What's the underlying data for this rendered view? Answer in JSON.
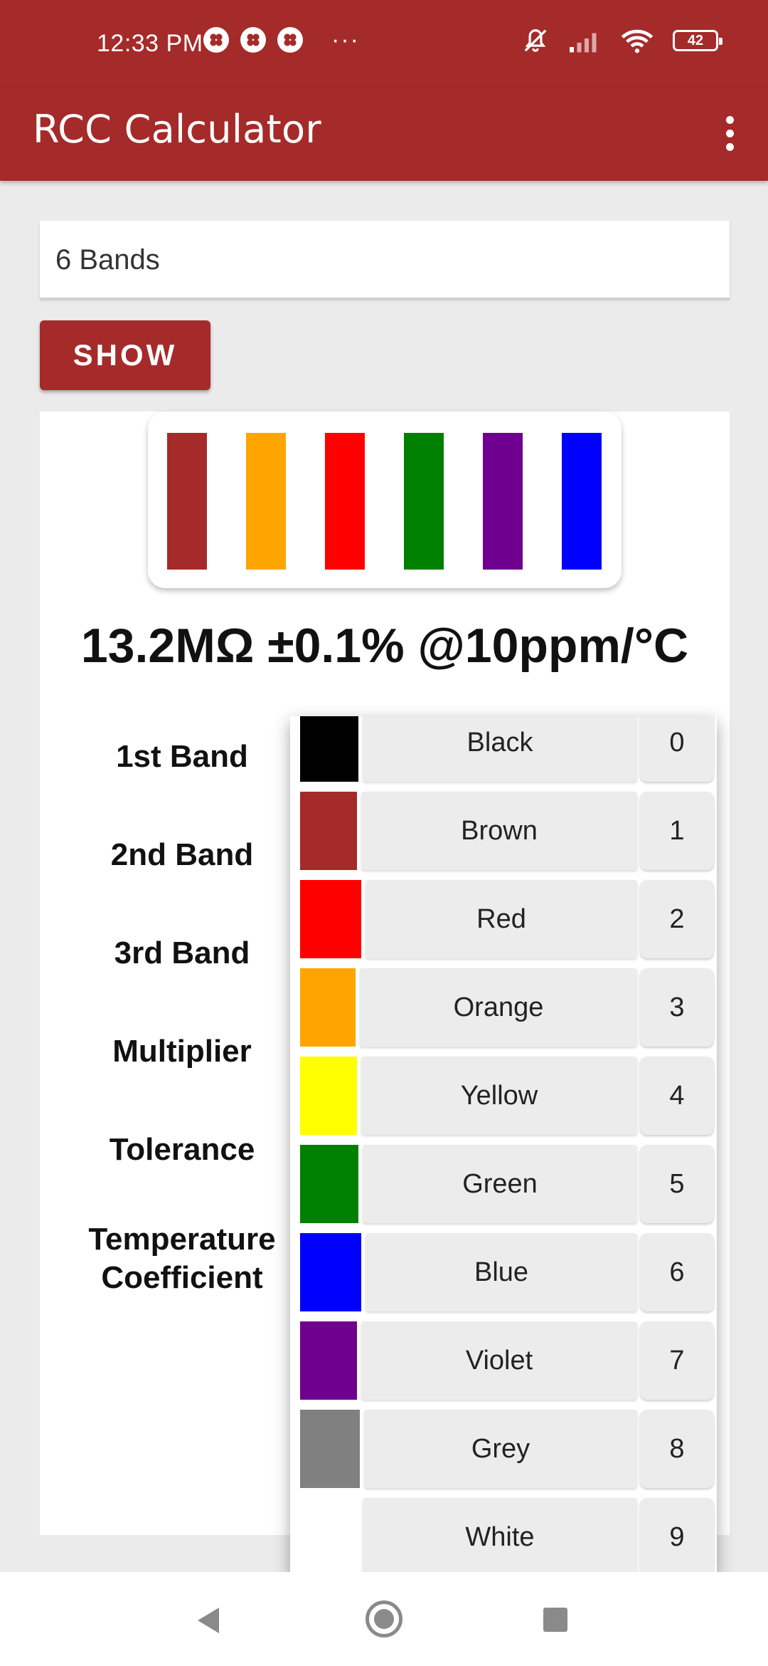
{
  "status_bar": {
    "time": "12:33 PM",
    "more_indicator": "···",
    "battery_level": "42",
    "icons": [
      "fan-icon",
      "fan-icon",
      "fan-icon",
      "mute-bell-icon",
      "signal-icon",
      "wifi-icon",
      "battery-icon"
    ]
  },
  "app_bar": {
    "title": "RCC Calculator",
    "menu_icon": "more-vert-icon"
  },
  "spinner": {
    "selected": "6 Bands"
  },
  "show_button": {
    "label": "SHOW"
  },
  "resistor": {
    "bands": [
      {
        "color": "#a52a2a"
      },
      {
        "color": "#ffa500"
      },
      {
        "color": "#ff0000"
      },
      {
        "color": "#008000"
      },
      {
        "color": "#6f008f"
      },
      {
        "color": "#0000ff"
      }
    ]
  },
  "result": "13.2MΩ ±0.1% @10ppm/°C",
  "labels": {
    "band1": "1st Band",
    "band2": "2nd Band",
    "band3": "3rd Band",
    "multiplier": "Multiplier",
    "tolerance": "Tolerance",
    "temp_line1": "Temperature",
    "temp_line2": "Coefficient"
  },
  "dropdown": {
    "items": [
      {
        "name": "Black",
        "digit": "0",
        "color": "#000000"
      },
      {
        "name": "Brown",
        "digit": "1",
        "color": "#a52a2a"
      },
      {
        "name": "Red",
        "digit": "2",
        "color": "#ff0000"
      },
      {
        "name": "Orange",
        "digit": "3",
        "color": "#ffa500"
      },
      {
        "name": "Yellow",
        "digit": "4",
        "color": "#ffff00"
      },
      {
        "name": "Green",
        "digit": "5",
        "color": "#008000"
      },
      {
        "name": "Blue",
        "digit": "6",
        "color": "#0000ff"
      },
      {
        "name": "Violet",
        "digit": "7",
        "color": "#6f008f"
      },
      {
        "name": "Grey",
        "digit": "8",
        "color": "#808080"
      },
      {
        "name": "White",
        "digit": "9",
        "color": "#ffffff"
      }
    ]
  },
  "nav": {
    "back_icon": "back-triangle-icon",
    "home_icon": "home-circle-icon",
    "recents_icon": "recents-square-icon"
  }
}
